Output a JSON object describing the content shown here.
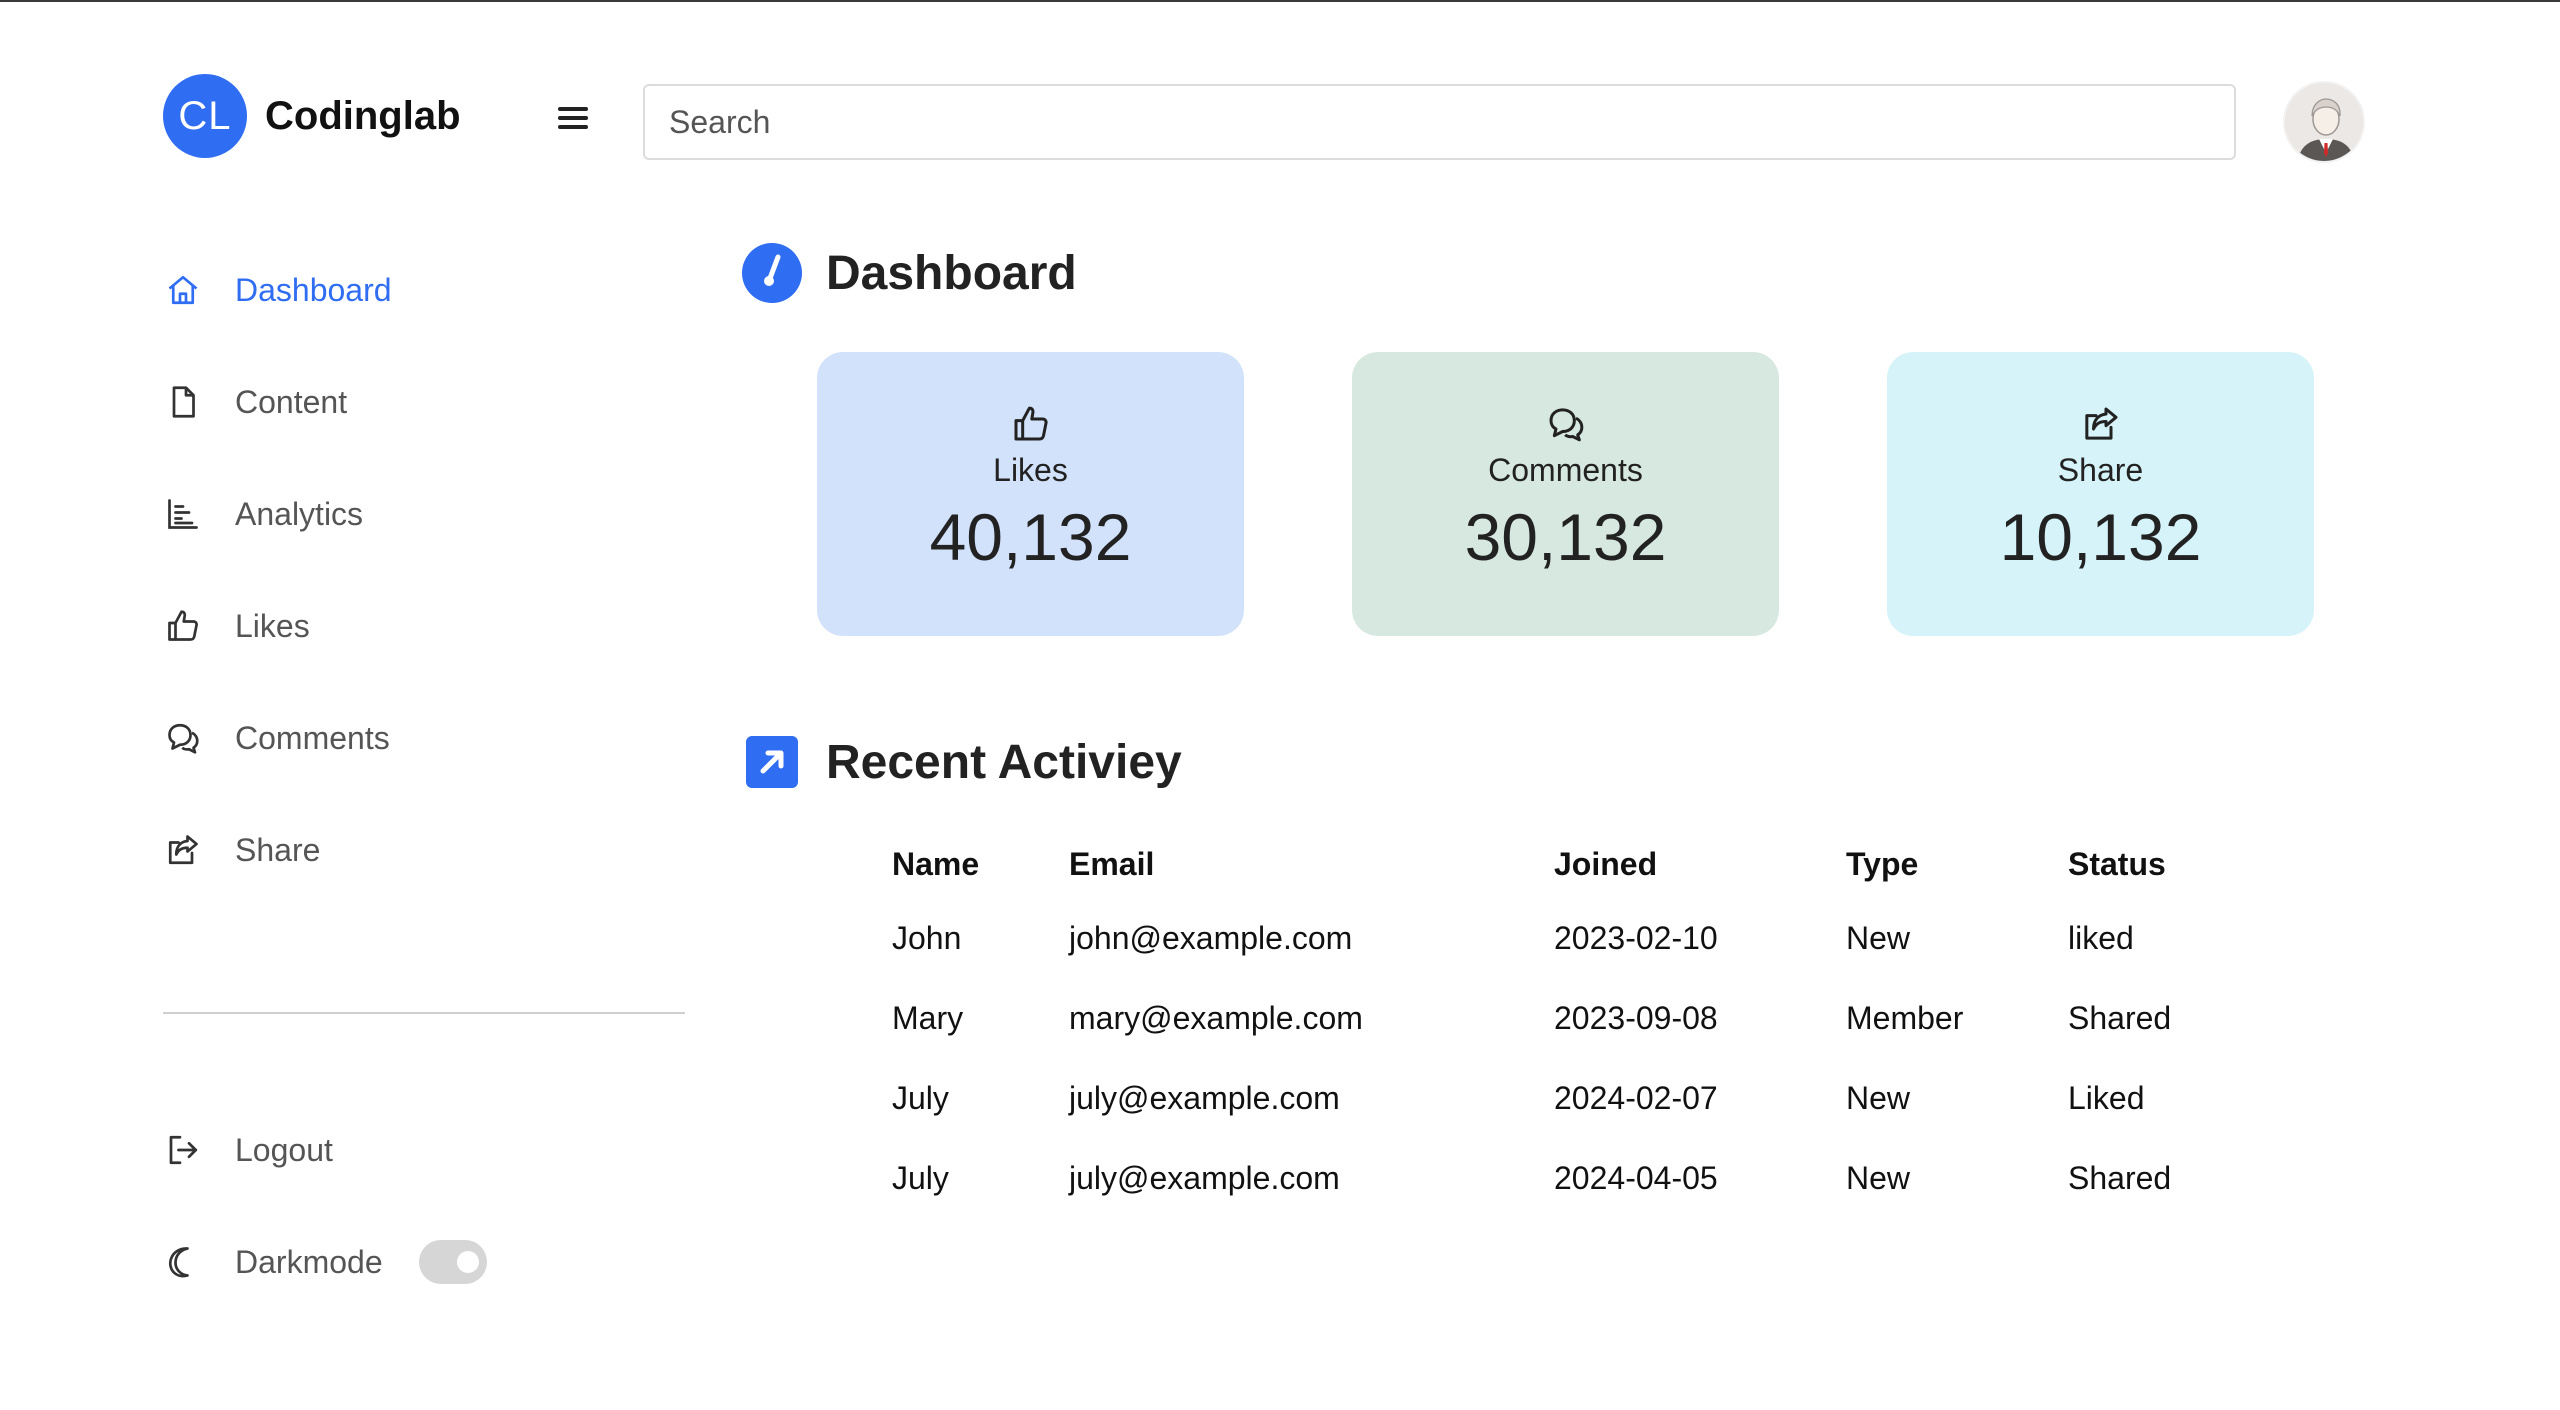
{
  "brand": {
    "logo_text": "CL",
    "name": "Codinglab",
    "accent": "#2f6df2"
  },
  "header": {
    "menu_icon": "hamburger-menu-icon",
    "search": {
      "placeholder": "Search",
      "value": ""
    },
    "avatar_icon": "user-avatar"
  },
  "sidebar": {
    "items": [
      {
        "label": "Dashboard",
        "icon": "home-icon",
        "active": true
      },
      {
        "label": "Content",
        "icon": "file-icon",
        "active": false
      },
      {
        "label": "Analytics",
        "icon": "bar-chart-icon",
        "active": false
      },
      {
        "label": "Likes",
        "icon": "thumbs-up-icon",
        "active": false
      },
      {
        "label": "Comments",
        "icon": "comments-icon",
        "active": false
      },
      {
        "label": "Share",
        "icon": "share-icon",
        "active": false
      }
    ],
    "bottom": {
      "logout": {
        "label": "Logout",
        "icon": "logout-icon"
      },
      "darkmode": {
        "label": "Darkmode",
        "icon": "moon-icon",
        "enabled": false
      }
    }
  },
  "dashboard": {
    "title": "Dashboard",
    "title_icon": "dashboard-gauge-icon",
    "cards": [
      {
        "label": "Likes",
        "value": "40,132",
        "icon": "thumbs-up-icon",
        "bg": "#d3e2fb"
      },
      {
        "label": "Comments",
        "value": "30,132",
        "icon": "comments-icon",
        "bg": "#d7e8e1"
      },
      {
        "label": "Share",
        "value": "10,132",
        "icon": "share-icon",
        "bg": "#d6f3f9"
      }
    ]
  },
  "recent": {
    "title": "Recent Activiey",
    "title_icon": "arrow-up-right-square-icon",
    "columns": [
      "Name",
      "Email",
      "Joined",
      "Type",
      "Status"
    ],
    "rows": [
      [
        "John",
        "john@example.com",
        "2023-02-10",
        "New",
        "liked"
      ],
      [
        "Mary",
        "mary@example.com",
        "2023-09-08",
        "Member",
        "Shared"
      ],
      [
        "July",
        "july@example.com",
        "2024-02-07",
        "New",
        "Liked"
      ],
      [
        "July",
        "july@example.com",
        "2024-04-05",
        "New",
        "Shared"
      ]
    ]
  }
}
